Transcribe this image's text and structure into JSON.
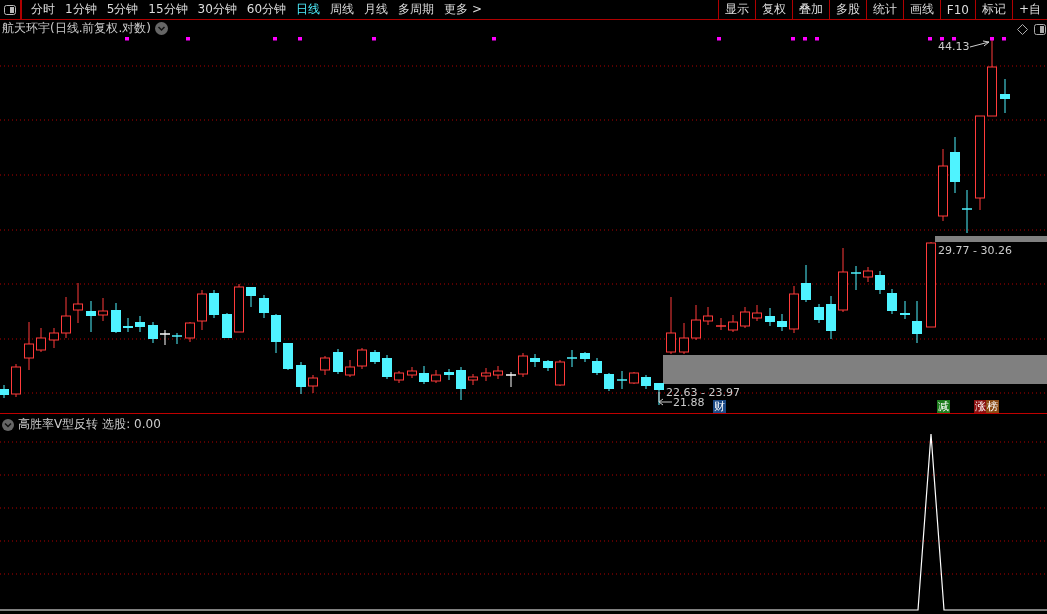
{
  "toolbar": {
    "periods": [
      {
        "label": "分时",
        "selected": false
      },
      {
        "label": "1分钟",
        "selected": false
      },
      {
        "label": "5分钟",
        "selected": false
      },
      {
        "label": "15分钟",
        "selected": false
      },
      {
        "label": "30分钟",
        "selected": false
      },
      {
        "label": "60分钟",
        "selected": false
      },
      {
        "label": "日线",
        "selected": true
      },
      {
        "label": "周线",
        "selected": false
      },
      {
        "label": "月线",
        "selected": false
      },
      {
        "label": "多周期",
        "selected": false
      },
      {
        "label": "更多 >",
        "selected": false
      }
    ],
    "buttons": [
      "显示",
      "复权",
      "叠加",
      "多股",
      "统计",
      "画线",
      "F10",
      "标记",
      "+自"
    ]
  },
  "main_chart": {
    "title": "航天环宇(日线.前复权.对数)",
    "high_label": "44.13",
    "upper_zone_label": "29.77 - 30.26",
    "lower_zone_label": "22.63 - 23.97",
    "low_label": "21.88",
    "event_badges": [
      {
        "text": "财",
        "color": "#1c4a86"
      },
      {
        "text": "减",
        "color": "#1d7d1d"
      },
      {
        "text": "涨",
        "color": "#8a1010"
      },
      {
        "text": "榜",
        "color": "#8a4a14"
      }
    ]
  },
  "indicator": {
    "name": "高胜率V型反转",
    "reading": "选股: 0.00"
  }
}
